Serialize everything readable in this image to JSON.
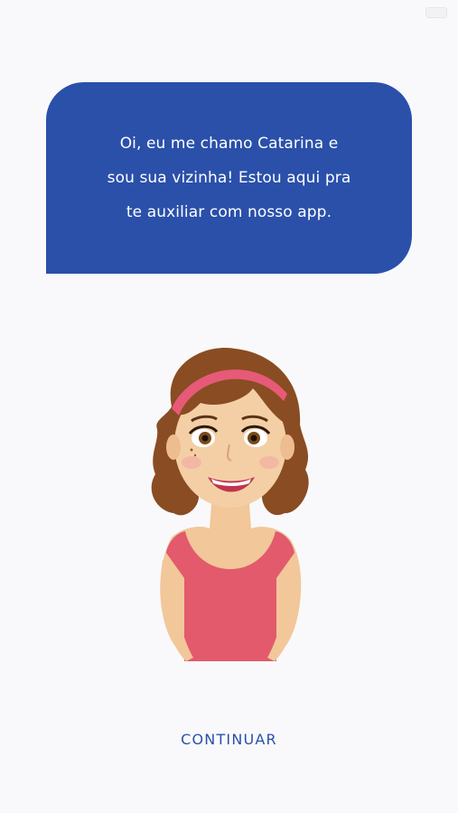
{
  "colors": {
    "background": "#f9f9fb",
    "accent": "#2a50aa",
    "bubble_text": "#ffffff"
  },
  "bubble": {
    "line1": "Oi, eu me chamo Catarina e",
    "line2": "sou sua vizinha! Estou aqui pra",
    "line3": "te auxiliar com nosso app."
  },
  "avatar": {
    "icon": "woman-avatar-illustration"
  },
  "continue_label": "CONTINUAR"
}
